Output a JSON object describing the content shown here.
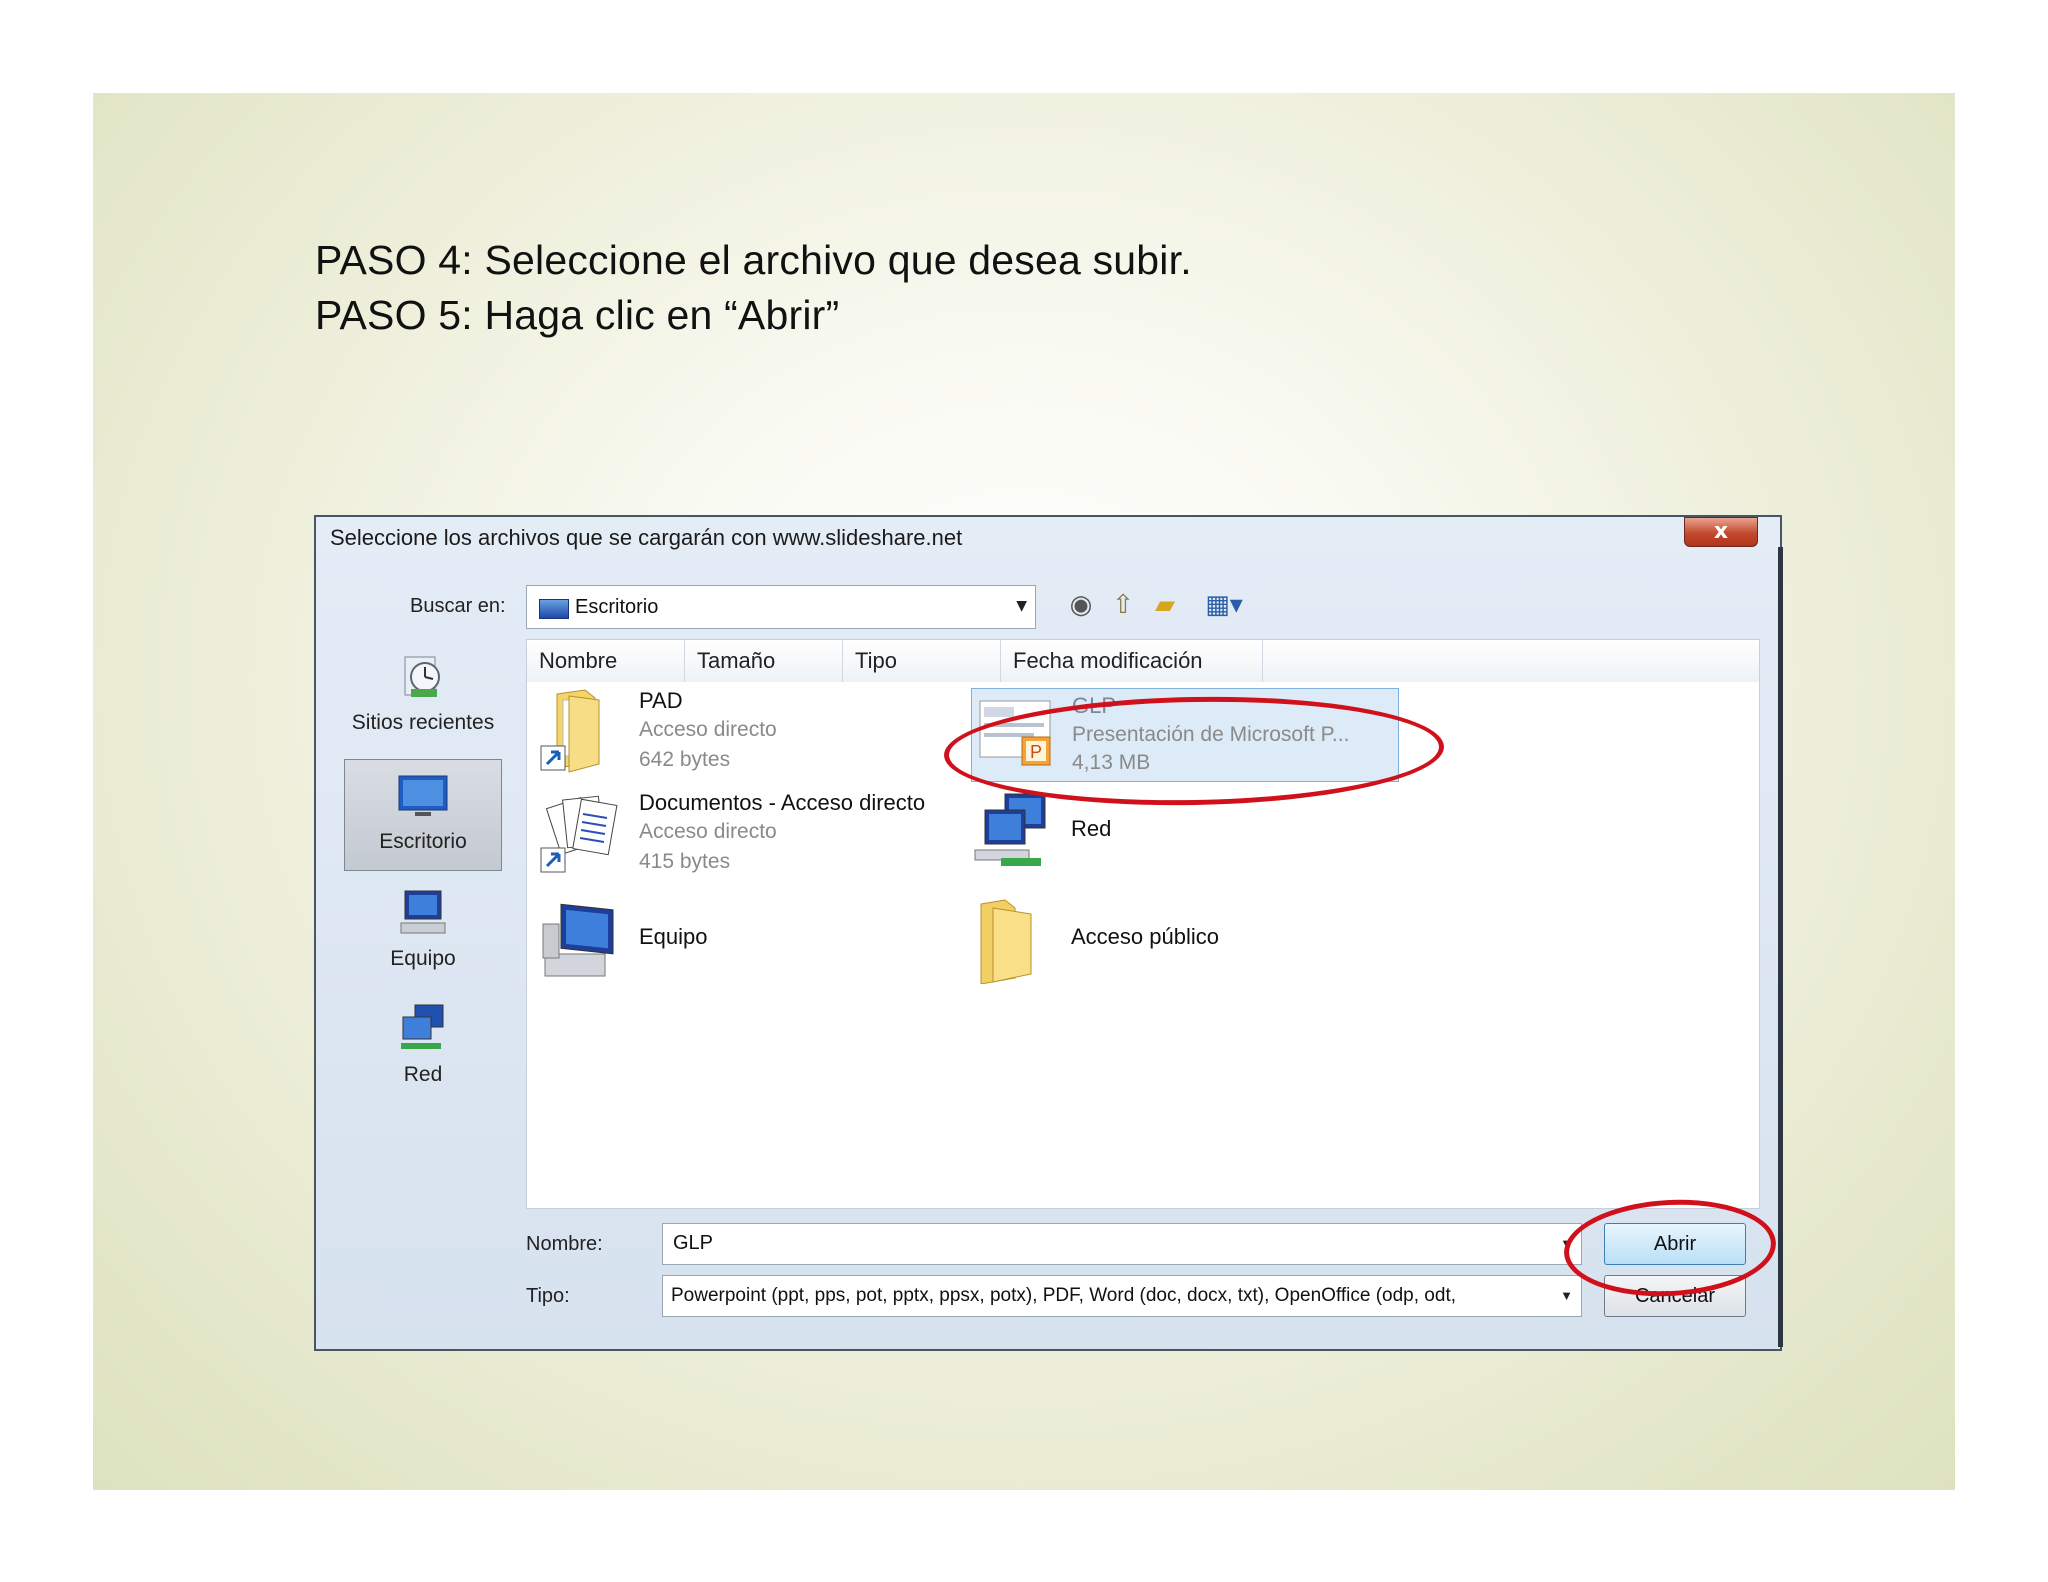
{
  "slide": {
    "step1": "PASO 4: Seleccione el archivo que desea subir.",
    "step2": "PASO 5: Haga clic en “Abrir”"
  },
  "dialog": {
    "title": "Seleccione los archivos que se cargarán con www.slideshare.net",
    "close_glyph": "x",
    "look_in_label": "Buscar en:",
    "look_in_value": "Escritorio",
    "toolbar_icons": [
      "back-icon",
      "up-folder-icon",
      "new-folder-icon",
      "views-menu-icon"
    ]
  },
  "places": [
    {
      "label": "Sitios recientes",
      "icon": "recent-places-icon"
    },
    {
      "label": "Escritorio",
      "icon": "desktop-icon",
      "selected": true
    },
    {
      "label": "Equipo",
      "icon": "computer-icon"
    },
    {
      "label": "Red",
      "icon": "network-icon"
    }
  ],
  "columns": [
    "Nombre",
    "Tamaño",
    "Tipo",
    "Fecha modificación"
  ],
  "files": {
    "pad": {
      "name": "PAD",
      "type": "Acceso directo",
      "size": "642 bytes"
    },
    "docs": {
      "name": "Documentos - Acceso directo",
      "type": "Acceso directo",
      "size": "415 bytes"
    },
    "equipo": {
      "name": "Equipo"
    },
    "glp": {
      "name": "GLP",
      "type": "Presentación de Microsoft P...",
      "size": "4,13 MB"
    },
    "red": {
      "name": "Red"
    },
    "publico": {
      "name": "Acceso público"
    }
  },
  "footer": {
    "name_label": "Nombre:",
    "name_value": "GLP",
    "type_label": "Tipo:",
    "type_value": "Powerpoint (ppt, pps, pot, pptx, ppsx, potx), PDF, Word (doc, docx, txt), OpenOffice (odp, odt,",
    "open_button": "Abrir",
    "cancel_button": "Cancelar"
  },
  "colors": {
    "annotation": "#d0111b",
    "selection": "#dcebf7"
  }
}
